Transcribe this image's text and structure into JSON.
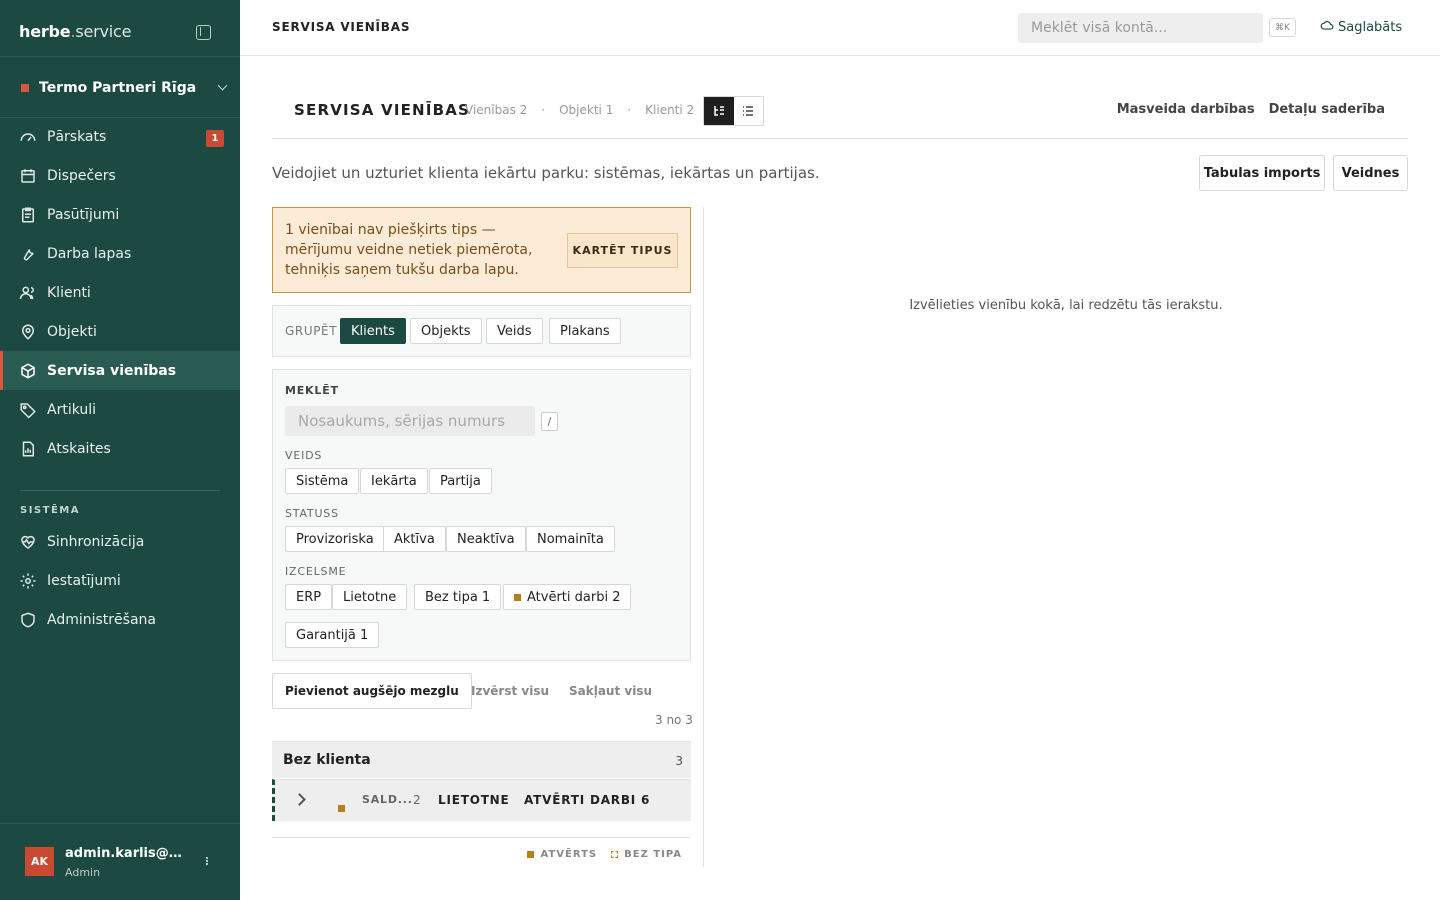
{
  "brand": {
    "name": "herbe",
    "dot": ".",
    "suffix": "service"
  },
  "org": {
    "name": "Termo Partneri Rīga"
  },
  "nav": [
    {
      "label": "Pārskats",
      "icon": "gauge-icon",
      "badge": "1"
    },
    {
      "label": "Dispečers",
      "icon": "calendar-icon"
    },
    {
      "label": "Pasūtījumi",
      "icon": "clipboard-icon"
    },
    {
      "label": "Darba lapas",
      "icon": "wrench-icon"
    },
    {
      "label": "Klienti",
      "icon": "users-icon"
    },
    {
      "label": "Objekti",
      "icon": "map-pin-icon"
    },
    {
      "label": "Servisa vienības",
      "icon": "box-icon",
      "active": true
    },
    {
      "label": "Artikuli",
      "icon": "tag-icon"
    },
    {
      "label": "Atskaites",
      "icon": "report-icon"
    }
  ],
  "system_label": "SISTĒMA",
  "nav2": [
    {
      "label": "Sinhronizācija",
      "icon": "heart-pulse-icon"
    },
    {
      "label": "Iestatījumi",
      "icon": "gear-icon"
    },
    {
      "label": "Administrēšana",
      "icon": "shield-icon"
    }
  ],
  "user": {
    "initials": "AK",
    "name": "admin.karlis@herbe.lv",
    "role": "Admin"
  },
  "topbar": {
    "crumb": "SERVISA VIENĪBAS",
    "search_placeholder": "Meklēt visā kontā...",
    "kbd": "⌘K",
    "saved": "Saglabāts"
  },
  "page": {
    "title": "SERVISA VIENĪBAS",
    "stats": [
      "Vienības 2",
      "Objekti 1",
      "Klienti 2"
    ],
    "stat_sep": "·",
    "actions": [
      "Masveida darbības",
      "Detaļu saderība"
    ],
    "description": "Veidojiet un uzturiet klienta iekārtu parku: sistēmas, iekārtas un partijas.",
    "buttons": {
      "import": "Tabulas imports",
      "templates": "Veidnes"
    }
  },
  "warning": {
    "text": "1 vienībai nav piešķirts tips — mērījumu veidne netiek piemērota, tehniķis saņem tukšu darba lapu.",
    "button": "KARTĒT TIPUS"
  },
  "group": {
    "label": "GRUPĒT",
    "options": [
      "Klients",
      "Objekts",
      "Veids",
      "Plakans"
    ],
    "selected": "Klients"
  },
  "filters": {
    "search_label": "MEKLĒT",
    "search_placeholder": "Nosaukums, sērijas numurs",
    "slash": "/",
    "type_label": "VEIDS",
    "types": [
      "Sistēma",
      "Iekārta",
      "Partija"
    ],
    "status_label": "STATUSS",
    "statuses": [
      "Provizoriska",
      "Aktīva",
      "Neaktīva",
      "Nomainīta"
    ],
    "highlight_label": "IZCELSME",
    "highlights": [
      "ERP",
      "Lietotne",
      "Bez tipa 1",
      "Atvērti darbi 2",
      "Garantijā 1"
    ]
  },
  "tree": {
    "add_root": "Pievienot augšējo mezglu",
    "expand_all": "Izvērst visu",
    "collapse_all": "Sakļaut visu",
    "count": "3 no 3",
    "group_title": "Bez klienta",
    "group_count": "3",
    "row": {
      "name": "SALD...",
      "num": "2",
      "tag1": "LIETOTNE",
      "tag2": "ATVĒRTI DARBI 6"
    },
    "legend": [
      "ATVĒRTS",
      "BEZ TIPA"
    ]
  },
  "detail": {
    "empty": "Izvēlieties vienību kokā, lai redzētu tās ierakstu."
  },
  "colors": {
    "sidebar": "#1c4a42",
    "accent": "#d9583a",
    "amber": "#b87d1e",
    "warning_bg": "#fcebd6"
  }
}
